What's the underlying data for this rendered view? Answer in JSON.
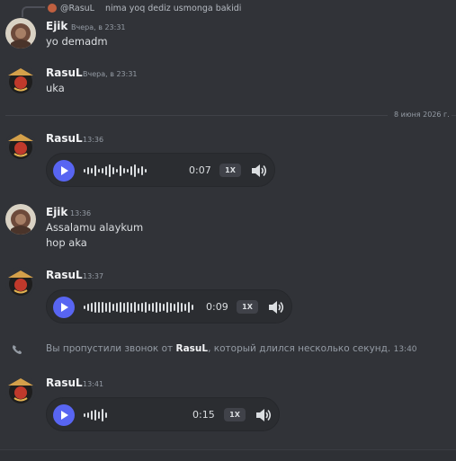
{
  "reply": {
    "author": "@RasuL",
    "text": "nima yoq dediz usmonga bakidi"
  },
  "messages": {
    "m1": {
      "author": "Ejik",
      "time": "Вчера, в 23:31",
      "lines": [
        "yo demadm"
      ]
    },
    "m2": {
      "author": "RasuL",
      "time": "Вчера, в 23:31",
      "lines": [
        "uka"
      ]
    },
    "m3": {
      "author": "RasuL",
      "time": "13:36",
      "voice": {
        "duration": "0:07",
        "speed": "1X"
      }
    },
    "m4": {
      "author": "Ejik",
      "time": "13:36",
      "lines": [
        "Assalamu alaykum",
        "hop aka"
      ]
    },
    "m5": {
      "author": "RasuL",
      "time": "13:37",
      "voice": {
        "duration": "0:09",
        "speed": "1X"
      }
    },
    "m6": {
      "author": "RasuL",
      "time": "13:41",
      "voice": {
        "duration": "0:15",
        "speed": "1X"
      }
    }
  },
  "divider": {
    "date": "8 июня 2026 г."
  },
  "missed_call": {
    "prefix": "Вы пропустили звонок от ",
    "caller": "RasuL",
    "suffix": ", который длился несколько секунд.",
    "time": "13:40"
  },
  "colors": {
    "accent": "#5865f2",
    "background": "#313338",
    "player": "#2b2d31"
  }
}
